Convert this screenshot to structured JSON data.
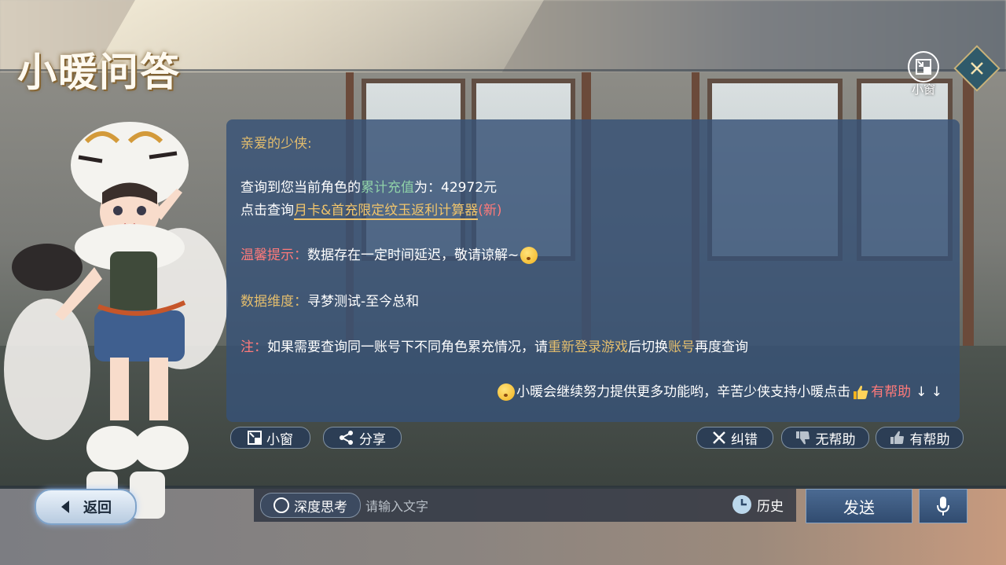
{
  "title": "小暖问答",
  "top_right": {
    "mini_window_label": "小窗"
  },
  "message": {
    "greeting": "亲爱的少侠:",
    "query_prefix": "查询到您当前角色的",
    "query_highlight": "累计充值",
    "query_suffix": "为：42972元",
    "click_prefix": "点击查询",
    "click_link": "月卡&首充限定纹玉返利计算器",
    "click_new": "(新)",
    "tip_label": "温馨提示：",
    "tip_text": "数据存在一定时间延迟，敬请谅解~",
    "dim_label": "数据维度：",
    "dim_text": "寻梦测试-至今总和",
    "note_label": "注：",
    "note_text_1": "如果需要查询同一账号下不同角色累充情况，请",
    "note_highlight_1": "重新登录游戏",
    "note_text_2": "后切换",
    "note_highlight_2": "账号",
    "note_text_3": "再度查询",
    "footer_text": "小暖会继续努力提供更多功能哟，辛苦少侠支持小暖点击",
    "footer_highlight": "有帮助",
    "footer_arrows": "↓ ↓"
  },
  "actions": {
    "mini_window": "小窗",
    "share": "分享",
    "correct": "纠错",
    "unhelpful": "无帮助",
    "helpful": "有帮助"
  },
  "bottom": {
    "back": "返回",
    "deep_think": "深度思考",
    "input_placeholder": "请输入文字",
    "history": "历史",
    "send": "发送"
  }
}
